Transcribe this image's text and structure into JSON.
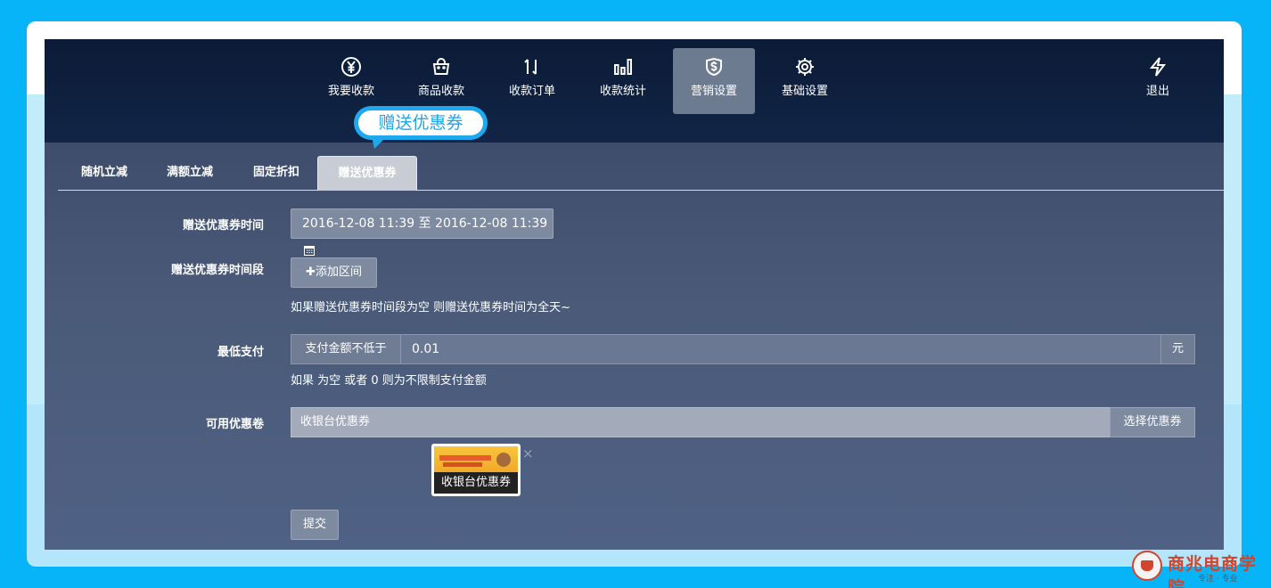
{
  "nav": {
    "items": [
      {
        "label": "我要收款",
        "icon": "yen-circle-icon"
      },
      {
        "label": "商品收款",
        "icon": "shopping-bag-icon"
      },
      {
        "label": "收款订单",
        "icon": "sort-arrows-icon"
      },
      {
        "label": "收款统计",
        "icon": "bar-chart-icon"
      },
      {
        "label": "营销设置",
        "icon": "dollar-shield-icon",
        "active": true
      },
      {
        "label": "基础设置",
        "icon": "gear-icon"
      }
    ],
    "logout": {
      "label": "退出",
      "icon": "lightning-icon"
    }
  },
  "tooltip": {
    "text": "赠送优惠券"
  },
  "tabs": [
    {
      "label": "随机立减"
    },
    {
      "label": "满额立减"
    },
    {
      "label": "固定折扣"
    },
    {
      "label": "赠送优惠券",
      "active": true
    }
  ],
  "form": {
    "time": {
      "label": "赠送优惠券时间",
      "value": "2016-12-08 11:39 至 2016-12-08 11:39",
      "icon": "calendar-icon"
    },
    "period": {
      "label": "赠送优惠券时间段",
      "button": "添加区间",
      "button_icon": "plus-icon",
      "help": "如果赠送优惠券时间段为空 则赠送优惠券时间为全天~"
    },
    "min_pay": {
      "label": "最低支付",
      "prefix": "支付金额不低于",
      "value": "0.01",
      "suffix": "元",
      "help": "如果 为空 或者 0 则为不限制支付金额"
    },
    "coupon": {
      "label": "可用优惠卷",
      "value": "收银台优惠券",
      "button": "选择优惠券",
      "selected_caption": "收银台优惠券",
      "remove": "×"
    },
    "submit": "提交"
  },
  "watermark": {
    "text": "商兆电商学院",
    "sub": "专注 · 专业"
  },
  "colors": {
    "outer": "#08b4f8",
    "accent": "#1ea9ee"
  }
}
